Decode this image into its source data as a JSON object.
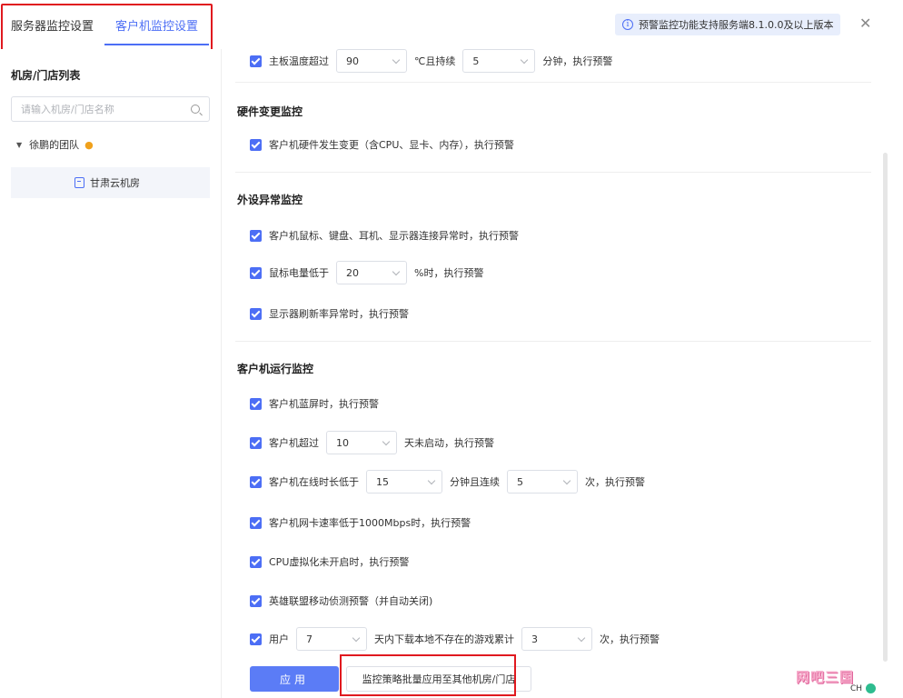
{
  "tabs": [
    "服务器监控设置",
    "客户机监控设置"
  ],
  "notice": "预警监控功能支持服务端8.1.0.0及以上版本",
  "close_glyph": "✕",
  "sidebar": {
    "title": "机房/门店列表",
    "search_placeholder": "请输入机房/门店名称",
    "team": "徐鹏的团队",
    "room": "甘肃云机房"
  },
  "main": {
    "board_temp": {
      "label": "主板温度超过",
      "value": "90",
      "unit": "℃且持续",
      "duration": "5",
      "suffix": "分钟，执行预警"
    },
    "hardware_section": "硬件变更监控",
    "hardware_change": "客户机硬件发生变更（含CPU、显卡、内存），执行预警",
    "peripheral_section": "外设异常监控",
    "peripheral_conn": "客户机鼠标、键盘、耳机、显示器连接异常时，执行预警",
    "mouse_battery": {
      "label": "鼠标电量低于",
      "value": "20",
      "suffix": "%时，执行预警"
    },
    "refresh_rate": "显示器刷新率异常时，执行预警",
    "runtime_section": "客户机运行监控",
    "bluescreen": "客户机蓝屏时，执行预警",
    "not_started": {
      "label": "客户机超过",
      "value": "10",
      "suffix": "天未启动，执行预警"
    },
    "online_time": {
      "label": "客户机在线时长低于",
      "value": "15",
      "mid": "分钟且连续",
      "count": "5",
      "suffix": "次，执行预警"
    },
    "nic_speed": "客户机网卡速率低于1000Mbps时，执行预警",
    "cpu_virt": "CPU虚拟化未开启时，执行预警",
    "lol_detect": "英雄联盟移动侦测预警（并自动关闭)",
    "game_download": {
      "label": "用户",
      "value": "7",
      "mid": "天内下载本地不存在的游戏累计",
      "count": "3",
      "suffix": "次，执行预警"
    }
  },
  "buttons": {
    "apply": "应用",
    "batch": "监控策略批量应用至其他机房/门店"
  },
  "watermark": "网吧三国",
  "tray": {
    "ime": "CH"
  },
  "colors": {
    "accent": "#4c6ef5",
    "highlight": "#e0191f"
  }
}
